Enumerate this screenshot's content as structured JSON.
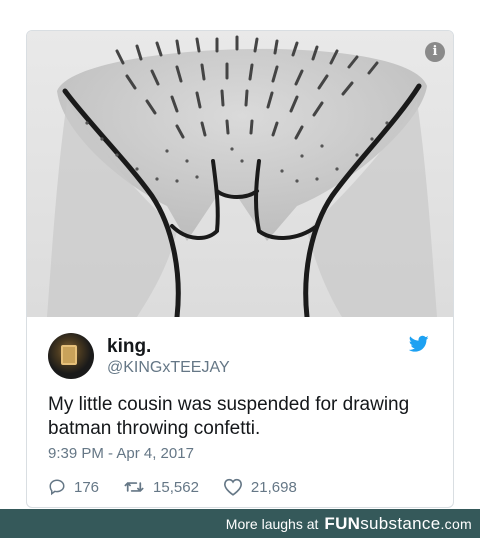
{
  "tweet": {
    "display_name": "king.",
    "handle": "@KINGxTEEJAY",
    "text": "My little cousin was suspended for drawing batman throwing confetti.",
    "timestamp": "9:39 PM - Apr 4, 2017",
    "replies": "176",
    "retweets": "15,562",
    "likes": "21,698"
  },
  "icons": {
    "info": "info-icon",
    "bird": "twitter-bird-icon",
    "reply": "reply-icon",
    "retweet": "retweet-icon",
    "like": "heart-icon"
  },
  "colors": {
    "twitter_blue": "#1da1f2",
    "secondary_text": "#657786",
    "footer_bg": "#35595a"
  },
  "footer": {
    "more_label": "More laughs at",
    "brand_fun": "FUN",
    "brand_sub": "substance",
    "brand_dotcom": ".com"
  }
}
